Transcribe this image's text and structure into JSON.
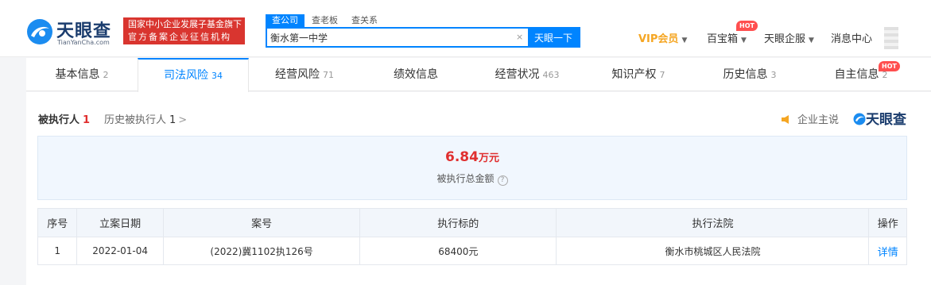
{
  "header": {
    "logo_cn": "天眼查",
    "logo_en": "TianYanCha.com",
    "gov_line1": "国家中小企业发展子基金旗下",
    "gov_line2": "官方备案企业征信机构",
    "search_tabs": [
      "查公司",
      "查老板",
      "查关系"
    ],
    "search_value": "衡水第一中学",
    "search_clear": "×",
    "search_button": "天眼一下",
    "vip": "VIP会员",
    "toolbox": "百宝箱",
    "enterprise": "天眼企服",
    "messages": "消息中心",
    "hot_badge": "HOT"
  },
  "tabs": [
    {
      "label": "基本信息",
      "count": "2"
    },
    {
      "label": "司法风险",
      "count": "34"
    },
    {
      "label": "经营风险",
      "count": "71"
    },
    {
      "label": "绩效信息",
      "count": ""
    },
    {
      "label": "经营状况",
      "count": "463"
    },
    {
      "label": "知识产权",
      "count": "7"
    },
    {
      "label": "历史信息",
      "count": "3"
    },
    {
      "label": "自主信息",
      "count": "2"
    }
  ],
  "section": {
    "active_subtab": "被执行人",
    "active_count": "1",
    "history_subtab": "历史被执行人",
    "history_count": "1",
    "history_arrow": ">",
    "enterprise_say": "企业主说",
    "brand": "天眼查"
  },
  "summary": {
    "amount": "6.84",
    "unit": "万元",
    "label": "被执行总金额",
    "help": "?"
  },
  "table": {
    "headers": [
      "序号",
      "立案日期",
      "案号",
      "执行标的",
      "执行法院",
      "操作"
    ],
    "rows": [
      [
        "1",
        "2022-01-04",
        "(2022)冀1102执126号",
        "68400元",
        "衡水市桃城区人民法院",
        "详情"
      ]
    ]
  },
  "colors": {
    "primary": "#0084ff",
    "danger": "#e02f2f",
    "vip": "#f5a623",
    "brand_navy": "#1b3d6e"
  }
}
